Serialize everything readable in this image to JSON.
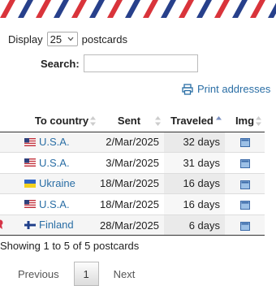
{
  "controls": {
    "display_label": "Display",
    "page_size": "25",
    "postcards_label": "postcards",
    "search_label": "Search:",
    "search_value": "",
    "print_label": "Print addresses"
  },
  "table": {
    "headers": [
      "To country",
      "Sent",
      "Traveled",
      "Img"
    ],
    "sorted_column": "Traveled",
    "rows": [
      {
        "country": "U.S.A.",
        "flag": "us-flag",
        "sent": "2/Mar/2025",
        "traveled": "32 days"
      },
      {
        "country": "U.S.A.",
        "flag": "us-flag",
        "sent": "3/Mar/2025",
        "traveled": "31 days"
      },
      {
        "country": "Ukraine",
        "flag": "ukraine-flag",
        "sent": "18/Mar/2025",
        "traveled": "16 days"
      },
      {
        "country": "U.S.A.",
        "flag": "us-flag",
        "sent": "18/Mar/2025",
        "traveled": "16 days"
      },
      {
        "country": "Finland",
        "flag": "finland-flag",
        "sent": "28/Mar/2025",
        "traveled": "6 days"
      }
    ]
  },
  "summary": "Showing 1 to 5 of 5 postcards",
  "pagination": {
    "previous": "Previous",
    "current_page": "1",
    "next": "Next"
  },
  "colors": {
    "link": "#2a6ea5",
    "airmail_red": "#d9343b",
    "airmail_blue": "#27408b"
  }
}
